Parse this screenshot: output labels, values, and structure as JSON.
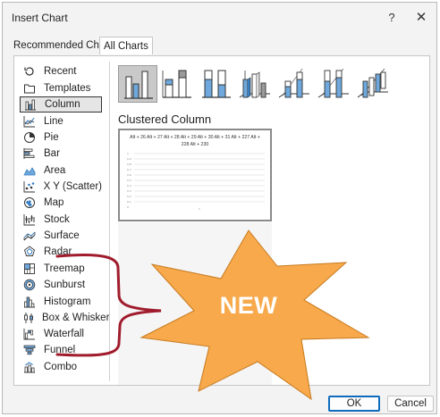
{
  "dialog": {
    "title": "Insert Chart",
    "help_glyph": "?",
    "close_glyph": "✕"
  },
  "tabs": [
    {
      "label": "Recommended Charts",
      "active": false
    },
    {
      "label": "All Charts",
      "active": true
    }
  ],
  "categories": [
    {
      "label": "Recent",
      "icon": "recent-icon"
    },
    {
      "label": "Templates",
      "icon": "templates-icon"
    },
    {
      "label": "Column",
      "icon": "column-chart-icon",
      "selected": true
    },
    {
      "label": "Line",
      "icon": "line-chart-icon"
    },
    {
      "label": "Pie",
      "icon": "pie-chart-icon"
    },
    {
      "label": "Bar",
      "icon": "bar-chart-icon"
    },
    {
      "label": "Area",
      "icon": "area-chart-icon"
    },
    {
      "label": "X Y (Scatter)",
      "icon": "scatter-chart-icon"
    },
    {
      "label": "Map",
      "icon": "map-chart-icon"
    },
    {
      "label": "Stock",
      "icon": "stock-chart-icon"
    },
    {
      "label": "Surface",
      "icon": "surface-chart-icon"
    },
    {
      "label": "Radar",
      "icon": "radar-chart-icon"
    },
    {
      "label": "Treemap",
      "icon": "treemap-chart-icon"
    },
    {
      "label": "Sunburst",
      "icon": "sunburst-chart-icon"
    },
    {
      "label": "Histogram",
      "icon": "histogram-chart-icon"
    },
    {
      "label": "Box & Whisker",
      "icon": "box-whisker-chart-icon"
    },
    {
      "label": "Waterfall",
      "icon": "waterfall-chart-icon"
    },
    {
      "label": "Funnel",
      "icon": "funnel-chart-icon"
    },
    {
      "label": "Combo",
      "icon": "combo-chart-icon"
    }
  ],
  "subtypes": [
    {
      "name": "clustered-column",
      "selected": true
    },
    {
      "name": "stacked-column"
    },
    {
      "name": "100-stacked-column"
    },
    {
      "name": "3d-clustered-column"
    },
    {
      "name": "3d-stacked-column"
    },
    {
      "name": "3d-100-stacked-column"
    },
    {
      "name": "3d-column"
    }
  ],
  "subtype_title": "Clustered Column",
  "preview": {
    "caption": "Alt + 26 Alt + 27 Alt + 28 Alt + 29 Alt + 30 Alt + 31 Alt + 227 Alt + 228 Alt + 230"
  },
  "annotation": {
    "text": "NEW",
    "star_color": "#f7a94b",
    "bracket_color": "#a01c2c"
  },
  "buttons": {
    "ok": "OK",
    "cancel": "Cancel"
  },
  "colors": {
    "accent": "#0f6cbd",
    "column_blue": "#6fa8dc"
  }
}
